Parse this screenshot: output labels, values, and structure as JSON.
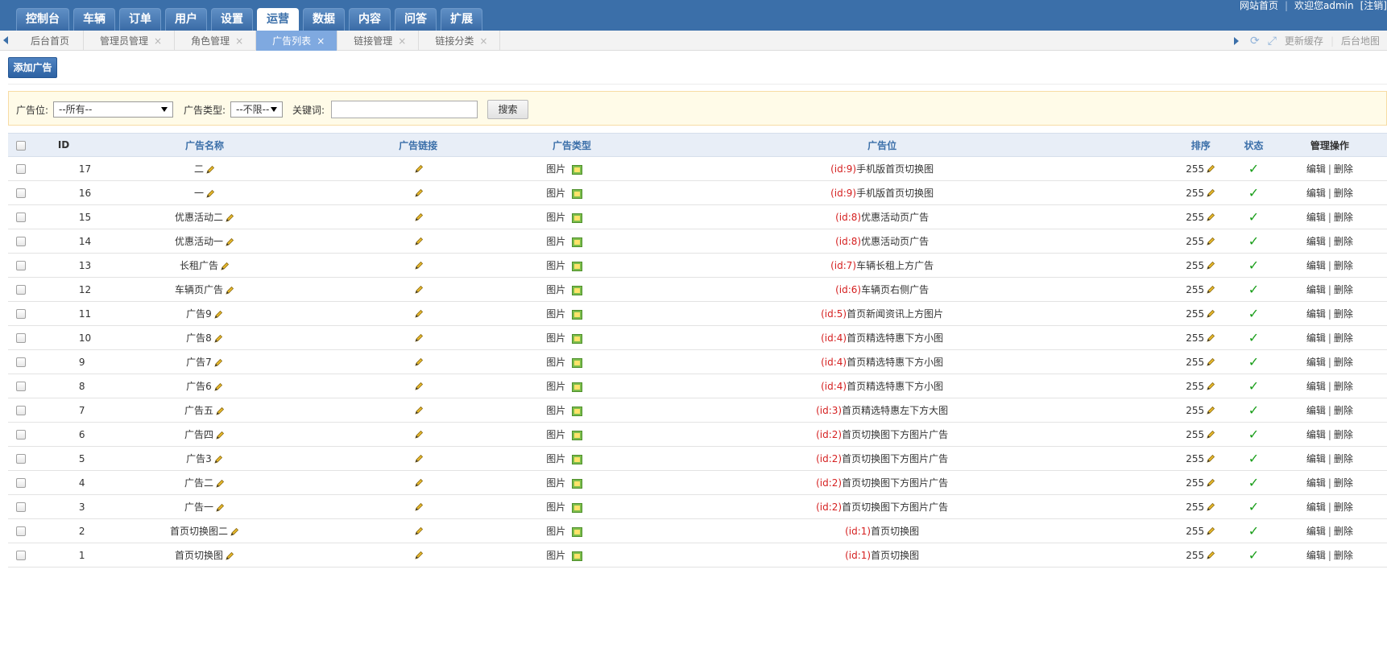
{
  "topnav": {
    "items": [
      "控制台",
      "车辆",
      "订单",
      "用户",
      "设置",
      "运营",
      "数据",
      "内容",
      "问答",
      "扩展"
    ],
    "active_index": 5
  },
  "top_links": {
    "home": "网站首页",
    "welcome": "欢迎您admin",
    "logout": "[注销]"
  },
  "tabs": {
    "items": [
      {
        "label": "后台首页",
        "closable": false
      },
      {
        "label": "管理员管理",
        "closable": true
      },
      {
        "label": "角色管理",
        "closable": true
      },
      {
        "label": "广告列表",
        "closable": true
      },
      {
        "label": "链接管理",
        "closable": true
      },
      {
        "label": "链接分类",
        "closable": true
      }
    ],
    "active_index": 3,
    "close_glyph": "×"
  },
  "tab_tools": {
    "refresh_icon": "refresh-icon",
    "fullscreen_icon": "fullscreen-icon",
    "update_cache": "更新缓存",
    "sitemap": "后台地图"
  },
  "toolbar": {
    "add_label": "添加广告"
  },
  "search": {
    "position_label": "广告位:",
    "position_value": "--所有--",
    "type_label": "广告类型:",
    "type_value": "--不限--",
    "keyword_label": "关键词:",
    "keyword_value": "",
    "button_label": "搜索"
  },
  "table": {
    "headers": {
      "id": "ID",
      "name": "广告名称",
      "link": "广告链接",
      "type": "广告类型",
      "position": "广告位",
      "sort": "排序",
      "status": "状态",
      "ops": "管理操作"
    },
    "edit_label": "编辑",
    "delete_label": "删除",
    "separator": "|",
    "status_glyph": "✓",
    "rows": [
      {
        "id": "17",
        "name": "二",
        "type": "图片",
        "pos_id": "(id:9)",
        "pos_name": "手机版首页切换图",
        "sort": "255"
      },
      {
        "id": "16",
        "name": "一",
        "type": "图片",
        "pos_id": "(id:9)",
        "pos_name": "手机版首页切换图",
        "sort": "255"
      },
      {
        "id": "15",
        "name": "优惠活动二",
        "type": "图片",
        "pos_id": "(id:8)",
        "pos_name": "优惠活动页广告",
        "sort": "255"
      },
      {
        "id": "14",
        "name": "优惠活动一",
        "type": "图片",
        "pos_id": "(id:8)",
        "pos_name": "优惠活动页广告",
        "sort": "255"
      },
      {
        "id": "13",
        "name": "长租广告",
        "type": "图片",
        "pos_id": "(id:7)",
        "pos_name": "车辆长租上方广告",
        "sort": "255"
      },
      {
        "id": "12",
        "name": "车辆页广告",
        "type": "图片",
        "pos_id": "(id:6)",
        "pos_name": "车辆页右侧广告",
        "sort": "255"
      },
      {
        "id": "11",
        "name": "广告9",
        "type": "图片",
        "pos_id": "(id:5)",
        "pos_name": "首页新闻资讯上方图片",
        "sort": "255"
      },
      {
        "id": "10",
        "name": "广告8",
        "type": "图片",
        "pos_id": "(id:4)",
        "pos_name": "首页精选特惠下方小图",
        "sort": "255"
      },
      {
        "id": "9",
        "name": "广告7",
        "type": "图片",
        "pos_id": "(id:4)",
        "pos_name": "首页精选特惠下方小图",
        "sort": "255"
      },
      {
        "id": "8",
        "name": "广告6",
        "type": "图片",
        "pos_id": "(id:4)",
        "pos_name": "首页精选特惠下方小图",
        "sort": "255"
      },
      {
        "id": "7",
        "name": "广告五",
        "type": "图片",
        "pos_id": "(id:3)",
        "pos_name": "首页精选特惠左下方大图",
        "sort": "255"
      },
      {
        "id": "6",
        "name": "广告四",
        "type": "图片",
        "pos_id": "(id:2)",
        "pos_name": "首页切换图下方图片广告",
        "sort": "255"
      },
      {
        "id": "5",
        "name": "广告3",
        "type": "图片",
        "pos_id": "(id:2)",
        "pos_name": "首页切换图下方图片广告",
        "sort": "255"
      },
      {
        "id": "4",
        "name": "广告二",
        "type": "图片",
        "pos_id": "(id:2)",
        "pos_name": "首页切换图下方图片广告",
        "sort": "255"
      },
      {
        "id": "3",
        "name": "广告一",
        "type": "图片",
        "pos_id": "(id:2)",
        "pos_name": "首页切换图下方图片广告",
        "sort": "255"
      },
      {
        "id": "2",
        "name": "首页切换图二",
        "type": "图片",
        "pos_id": "(id:1)",
        "pos_name": "首页切换图",
        "sort": "255"
      },
      {
        "id": "1",
        "name": "首页切换图",
        "type": "图片",
        "pos_id": "(id:1)",
        "pos_name": "首页切换图",
        "sort": "255"
      }
    ]
  },
  "colors": {
    "topbar": "#3b6fa9",
    "header_text": "#3b6fa9",
    "position_id": "#d52020",
    "status_ok": "#1a9e1a",
    "active_tab": "#7fa9e0"
  }
}
